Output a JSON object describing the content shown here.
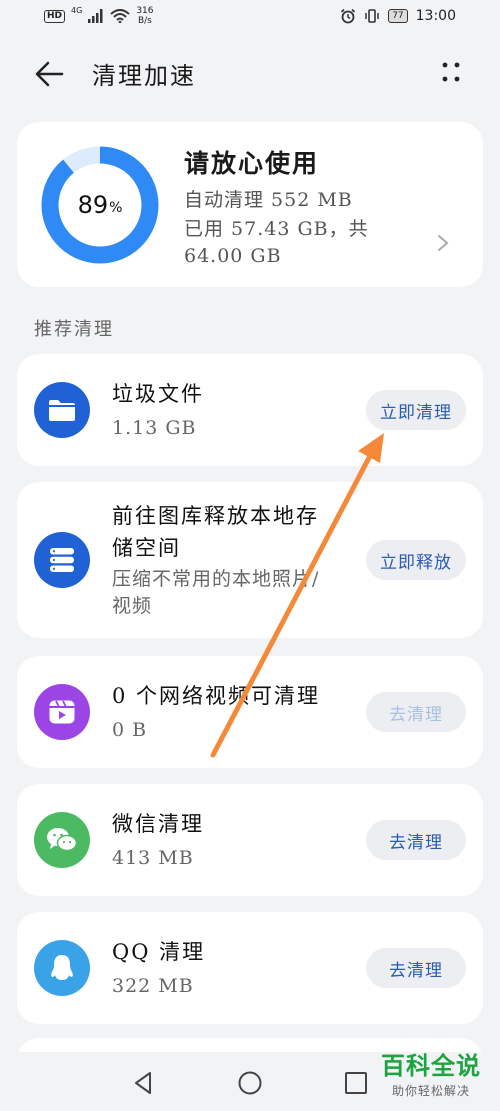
{
  "status_bar": {
    "hd": "HD",
    "network": "4G",
    "speed_value": "316",
    "speed_unit": "B/s",
    "battery": "77",
    "time": "13:00"
  },
  "header": {
    "title": "清理加速"
  },
  "storage": {
    "percent_value": "89",
    "percent_sign": "%",
    "percent": 89,
    "title": "请放心使用",
    "auto_clean": "自动清理 552 MB",
    "used_line1": "已用 57.43 GB，共",
    "used_line2": "64.00 GB",
    "ring_color": "#2f8af5",
    "ring_track": "#dcebfd"
  },
  "section_label": "推荐清理",
  "items": [
    {
      "title": "垃圾文件",
      "subtitle": "1.13 GB",
      "button": "立即清理",
      "icon": "folder-icon",
      "icon_color": "#2161d6"
    },
    {
      "title_line1": "前往图库释放本地存",
      "title_line2": "储空间",
      "sub_line1": "压缩不常用的本地照片/",
      "sub_line2": "视频",
      "button": "立即释放",
      "icon": "storage-icon",
      "icon_color": "#2161d6"
    },
    {
      "title": "0 个网络视频可清理",
      "subtitle": "0 B",
      "button": "去清理",
      "icon": "video-icon",
      "icon_color": "#9b45e6"
    },
    {
      "title": "微信清理",
      "subtitle": "413 MB",
      "button": "去清理",
      "icon": "wechat-icon",
      "icon_color": "#4cb963"
    },
    {
      "title": "QQ 清理",
      "subtitle": "322 MB",
      "button": "去清理",
      "icon": "qq-icon",
      "icon_color": "#3aa3e8"
    }
  ],
  "watermark": {
    "main": "百科全说",
    "sub": "助你轻松解决"
  },
  "colors": {
    "accent": "#2a5db0",
    "annotation_arrow": "#f5893a"
  }
}
